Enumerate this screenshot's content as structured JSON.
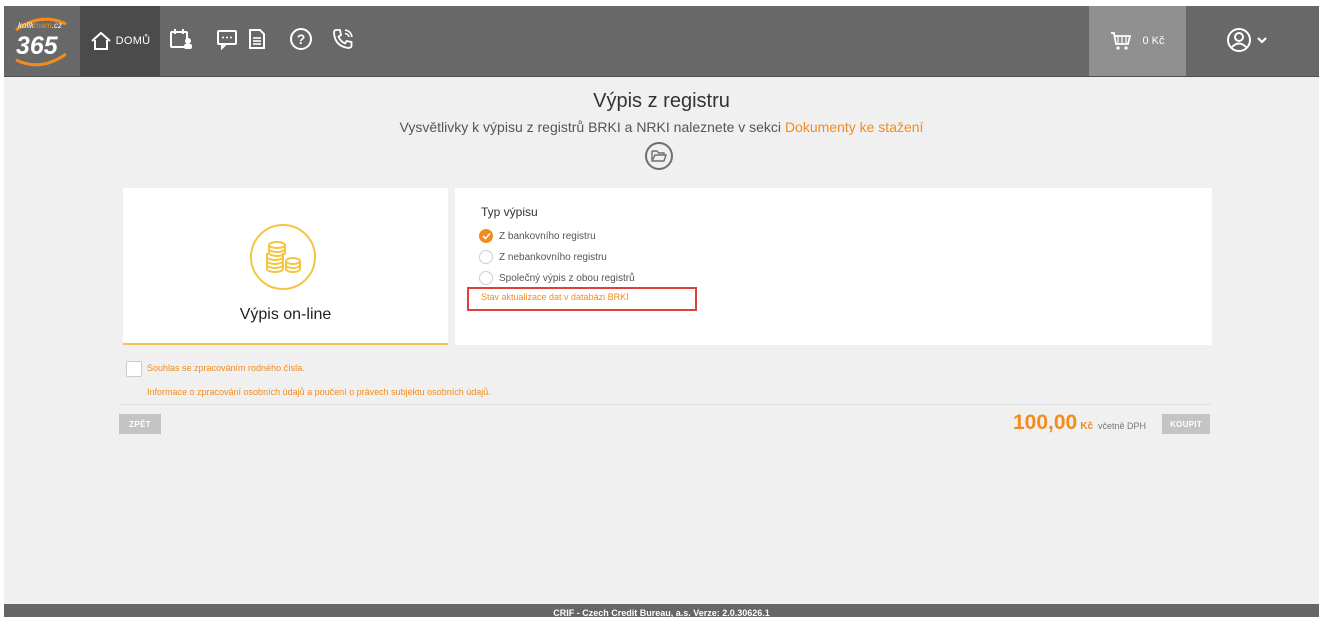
{
  "header": {
    "logo_top": "kolikmam.cz",
    "logo_number": "365",
    "home_label": "DOMŮ",
    "cart_label": "0 Kč"
  },
  "page": {
    "title": "Výpis z registru",
    "subtitle_prefix": "Vysvětlivky k výpisu z registrů BRKI a NRKI naleznete v sekci",
    "subtitle_link": "Dokumenty ke stažení"
  },
  "card": {
    "label": "Výpis on-line"
  },
  "typ": {
    "heading": "Typ výpisu",
    "options": [
      {
        "label": "Z bankovního registru",
        "selected": true
      },
      {
        "label": "Z nebankovního registru",
        "selected": false
      },
      {
        "label": "Společný výpis z obou registrů",
        "selected": false
      }
    ],
    "status_link": "Stav aktualizace dat v databázi BRKI"
  },
  "consent": {
    "label": "Souhlas se zpracováním rodného čísla.",
    "info": "Informace o zpracování osobních údajů a poučení o právech subjektu osobních údajů."
  },
  "actions": {
    "back": "ZPĚT",
    "price": "100,00",
    "currency": "Kč",
    "vat": "včetně DPH",
    "buy": "KOUPIT"
  },
  "footer": {
    "text": "CRIF - Czech Credit Bureau, a.s. Verze: 2.0.30626.1"
  },
  "colors": {
    "accent": "#f28c1c",
    "header_bg": "#686868",
    "coin": "#f4c542"
  }
}
